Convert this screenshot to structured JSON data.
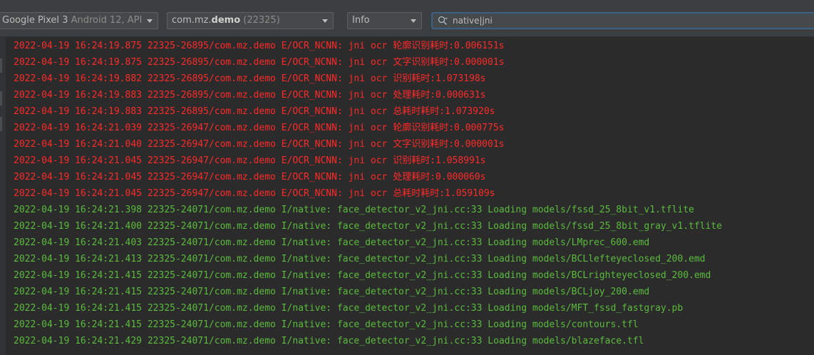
{
  "toolbar": {
    "device": {
      "name": "Google Pixel 3",
      "detail": "Android 12, API"
    },
    "process": {
      "prefix": "com.mz.",
      "bold": "demo",
      "pid": "(22325)"
    },
    "log_level": "Info",
    "search": {
      "value": "native|jni"
    }
  },
  "log_lines": [
    {
      "level": "error",
      "text": "2022-04-19 16:24:19.875 22325-26895/com.mz.demo E/OCR_NCNN: jni ocr 轮廓识别耗时:0.006151s"
    },
    {
      "level": "error",
      "text": "2022-04-19 16:24:19.875 22325-26895/com.mz.demo E/OCR_NCNN: jni ocr 文字识别耗时:0.000001s"
    },
    {
      "level": "error",
      "text": "2022-04-19 16:24:19.882 22325-26895/com.mz.demo E/OCR_NCNN: jni ocr 识别耗时:1.073198s"
    },
    {
      "level": "error",
      "text": "2022-04-19 16:24:19.883 22325-26895/com.mz.demo E/OCR_NCNN: jni ocr 处理耗时:0.000631s"
    },
    {
      "level": "error",
      "text": "2022-04-19 16:24:19.883 22325-26895/com.mz.demo E/OCR_NCNN: jni ocr 总耗时耗时:1.073920s"
    },
    {
      "level": "error",
      "text": "2022-04-19 16:24:21.039 22325-26947/com.mz.demo E/OCR_NCNN: jni ocr 轮廓识别耗时:0.000775s"
    },
    {
      "level": "error",
      "text": "2022-04-19 16:24:21.040 22325-26947/com.mz.demo E/OCR_NCNN: jni ocr 文字识别耗时:0.000001s"
    },
    {
      "level": "error",
      "text": "2022-04-19 16:24:21.045 22325-26947/com.mz.demo E/OCR_NCNN: jni ocr 识别耗时:1.058991s"
    },
    {
      "level": "error",
      "text": "2022-04-19 16:24:21.045 22325-26947/com.mz.demo E/OCR_NCNN: jni ocr 处理耗时:0.000060s"
    },
    {
      "level": "error",
      "text": "2022-04-19 16:24:21.045 22325-26947/com.mz.demo E/OCR_NCNN: jni ocr 总耗时耗时:1.059109s"
    },
    {
      "level": "info",
      "text": "2022-04-19 16:24:21.398 22325-24071/com.mz.demo I/native: face_detector_v2_jni.cc:33 Loading models/fssd_25_8bit_v1.tflite"
    },
    {
      "level": "info",
      "text": "2022-04-19 16:24:21.400 22325-24071/com.mz.demo I/native: face_detector_v2_jni.cc:33 Loading models/fssd_25_8bit_gray_v1.tflite"
    },
    {
      "level": "info",
      "text": "2022-04-19 16:24:21.403 22325-24071/com.mz.demo I/native: face_detector_v2_jni.cc:33 Loading models/LMprec_600.emd"
    },
    {
      "level": "info",
      "text": "2022-04-19 16:24:21.413 22325-24071/com.mz.demo I/native: face_detector_v2_jni.cc:33 Loading models/BCLlefteyeclosed_200.emd"
    },
    {
      "level": "info",
      "text": "2022-04-19 16:24:21.415 22325-24071/com.mz.demo I/native: face_detector_v2_jni.cc:33 Loading models/BCLrighteyeclosed_200.emd"
    },
    {
      "level": "info",
      "text": "2022-04-19 16:24:21.415 22325-24071/com.mz.demo I/native: face_detector_v2_jni.cc:33 Loading models/BCLjoy_200.emd"
    },
    {
      "level": "info",
      "text": "2022-04-19 16:24:21.415 22325-24071/com.mz.demo I/native: face_detector_v2_jni.cc:33 Loading models/MFT_fssd_fastgray.pb"
    },
    {
      "level": "info",
      "text": "2022-04-19 16:24:21.415 22325-24071/com.mz.demo I/native: face_detector_v2_jni.cc:33 Loading models/contours.tfl"
    },
    {
      "level": "info",
      "text": "2022-04-19 16:24:21.429 22325-24071/com.mz.demo I/native: face_detector_v2_jni.cc:33 Loading models/blazeface.tfl"
    }
  ],
  "colors": {
    "error": "#ff2a2a",
    "info": "#5bbb3d",
    "background": "#2b2b2b",
    "toolbar": "#3c3f41"
  },
  "icons": {
    "search": "search-icon",
    "dropdown": "chevron-down-icon"
  }
}
